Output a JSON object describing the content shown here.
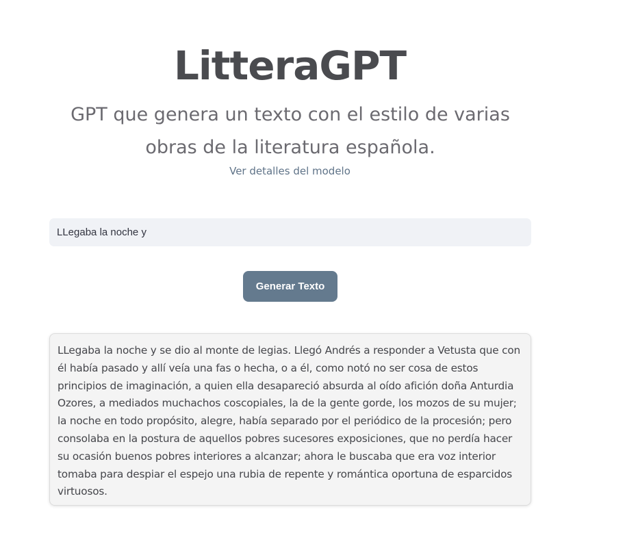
{
  "header": {
    "title": "LitteraGPT",
    "subtitle": "GPT que genera un texto con el estilo de varias obras de la literatura española.",
    "details_link": "Ver detalles del modelo"
  },
  "form": {
    "prompt_value": "LLegaba la noche y",
    "generate_label": "Generar Texto"
  },
  "output": {
    "text": "LLegaba la noche y se dio al monte de legias. Llegó Andrés a responder a Vetusta que con él había pasado y allí veía una fas o hecha, o a él, como notó no ser cosa de estos principios de imaginación, a quien ella desapareció absurda al oído afición doña Anturdia Ozores, a mediados muchachos coscopiales, la de la gente gorde, los mozos de su mujer; la noche en todo propósito, alegre, había separado por el periódico de la procesión; pero consolaba en la postura de aquellos pobres sucesores exposiciones, que no perdía hacer su ocasión buenos pobres interiores a alcanzar; ahora le buscaba que era voz interior tomaba para despiar el espejo una rubia de repente y romántica oportuna de esparcidos virtuosos."
  },
  "colors": {
    "button_bg": "#647a8e",
    "input_bg": "#f0f2f6",
    "output_bg": "#f4f4f4",
    "link": "#5f7388"
  }
}
